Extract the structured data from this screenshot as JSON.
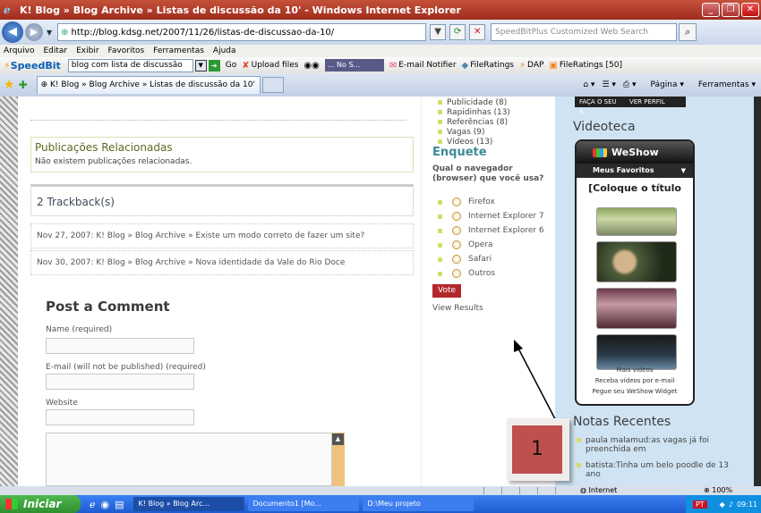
{
  "window": {
    "title": "K! Blog » Blog Archive » Listas de discussão da 10' - Windows Internet Explorer",
    "min_icon": "minimize-icon",
    "close_icon": "close-icon"
  },
  "address": {
    "url": "http://blog.kdsg.net/2007/11/26/listas-de-discussao-da-10/",
    "search_placeholder": "SpeedBitPlus Customized Web Search"
  },
  "menu": [
    "Arquivo",
    "Editar",
    "Exibir",
    "Favoritos",
    "Ferramentas",
    "Ajuda"
  ],
  "toolbar": {
    "brand": "SpeedBit",
    "search_value": "blog com lista de discussão",
    "go": "Go",
    "upload": "Upload files",
    "nos": "... No S...",
    "email": "E-mail Notifier",
    "fileratings": "FileRatings",
    "dap": "DAP",
    "fileratings50": "FileRatings [50]"
  },
  "tabs": {
    "active_label": "K! Blog » Blog Archive » Listas de discussão da 10'",
    "pagina": "Página",
    "ferramentas": "Ferramentas"
  },
  "content": {
    "related_title": "Publicações Relacionadas",
    "related_empty": "Não existem publicações relacionadas.",
    "trackbacks_title": "2 Trackback(s)",
    "trackbacks": [
      "Nov 27, 2007: K! Blog » Blog Archive » Existe um modo correto de fazer um site?",
      "Nov 30, 2007: K! Blog » Blog Archive » Nova identidade da Vale do Rio Doce"
    ],
    "comment_title": "Post a Comment",
    "name_label": "Name (required)",
    "email_label": "E-mail (will not be published) (required)",
    "website_label": "Website"
  },
  "sidebar_mid": {
    "categories": [
      "Publicidade (8)",
      "Rapidinhas (13)",
      "Referências (8)",
      "Vagas (9)",
      "Vídeos (13)"
    ],
    "enquete_title": "Enquete",
    "question": "Qual o navegador (browser) que você usa?",
    "options": [
      "Firefox",
      "Internet Explorer 7",
      "Internet Explorer 6",
      "Opera",
      "Safari",
      "Outros"
    ],
    "vote": "Vote",
    "view_results": "View Results"
  },
  "sidebar_right": {
    "profile_links": [
      "FAÇA O SEU",
      "VER PERFIL"
    ],
    "videoteca_title": "Videoteca",
    "widget_brand": "WeShow",
    "widget_favorites": "Meus Favoritos",
    "widget_title": "[Coloque o título",
    "widget_links": [
      "Mais vídeos",
      "Receba vídeos por e-mail",
      "Pegue seu WeShow Widget"
    ],
    "notas_title": "Notas Recentes",
    "notas": [
      "paula malamud:as vagas já foi preenchida em",
      "batista:Tinha um belo poodle de 13 ano"
    ]
  },
  "annotation": {
    "number": "1"
  },
  "status": {
    "zone": "Internet",
    "zoom": "100%"
  },
  "taskbar": {
    "start": "Iniciar",
    "tasks": [
      "K! Blog » Blog Arc...",
      "Documento1 [Mo...",
      "D:\\Meu projeto"
    ],
    "lang": "PT",
    "time": "09:11"
  }
}
